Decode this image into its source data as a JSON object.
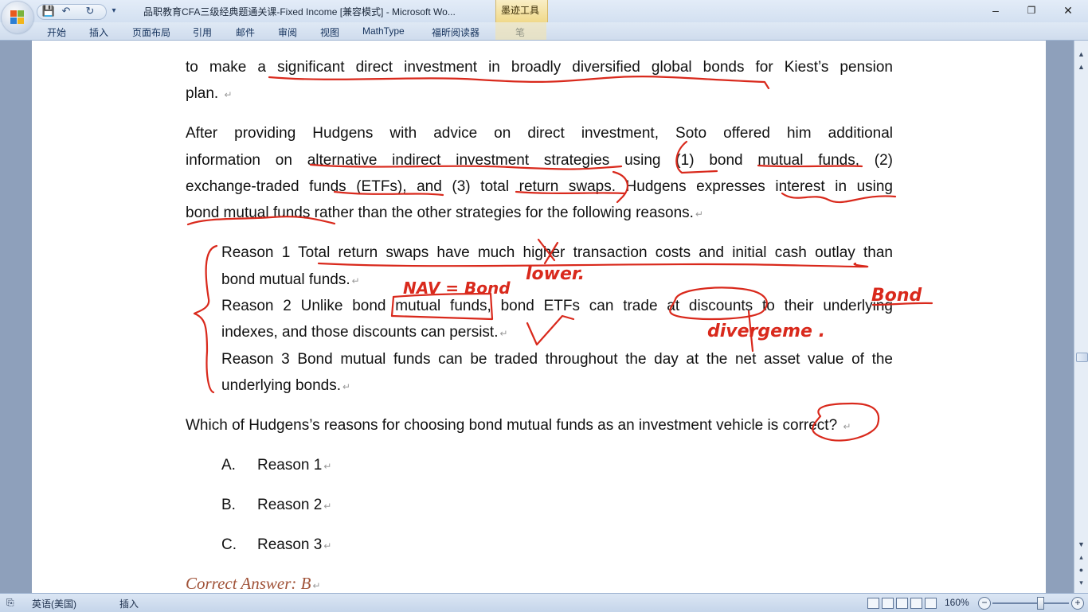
{
  "window": {
    "title": "品职教育CFA三级经典题通关课-Fixed Income [兼容模式] - Microsoft Wo...",
    "context_tab": "墨迹工具",
    "controls": {
      "minimize": "–",
      "restore": "❐",
      "close": "✕"
    }
  },
  "quick_access": {
    "save": "💾",
    "undo": "↶",
    "redo": "↻",
    "customize": "▾"
  },
  "ribbon_tabs": [
    "开始",
    "插入",
    "页面布局",
    "引用",
    "邮件",
    "审阅",
    "视图",
    "MathType",
    "福昕阅读器",
    "笔"
  ],
  "help": "?",
  "document": {
    "para1_line1": "to make a significant direct investment in broadly diversified global bonds for Kiest’s pension",
    "para1_line2": "plan.",
    "para2_line1": "After providing Hudgens with advice on direct investment, Soto offered him additional",
    "para2_line2": "information on alternative indirect investment strategies using (1) bond mutual funds, (2)",
    "para2_line3": "exchange-traded funds (ETFs), and (3) total return swaps. Hudgens expresses interest in using",
    "para2_line4": "bond mutual funds rather than the other strategies for the following reasons.",
    "reason1_line1": "Reason 1 Total return swaps have much higher transaction costs and initial cash outlay than",
    "reason1_line2": "bond mutual funds.",
    "reason2_line1": "Reason 2 Unlike bond mutual funds, bond ETFs can trade at discounts to their underlying",
    "reason2_line2": "indexes, and those discounts can persist.",
    "reason3_line1": "Reason 3 Bond mutual funds can be traded throughout the day at the net asset value of the",
    "reason3_line2": "underlying bonds.",
    "question": "Which of Hudgens’s reasons for choosing bond mutual funds as an investment vehicle is correct?",
    "options": [
      {
        "letter": "A.",
        "text": "Reason 1"
      },
      {
        "letter": "B.",
        "text": "Reason 2"
      },
      {
        "letter": "C.",
        "text": "Reason 3"
      }
    ],
    "answer": "Correct Answer: B",
    "paragraph_mark": "↵"
  },
  "ink_notes": [
    "lower.",
    "NAV = Bond",
    "Bond",
    "divergeme ."
  ],
  "ink_color": "#d9291c",
  "status": {
    "language": "英语(美国)",
    "insert_mode": "插入",
    "zoom": "160%",
    "zoom_out": "−",
    "zoom_in": "+",
    "zoom_level": 0.62
  },
  "scroll": {
    "up": "▲",
    "down": "▼",
    "prev": "▴",
    "next": "▾",
    "select": "●"
  }
}
